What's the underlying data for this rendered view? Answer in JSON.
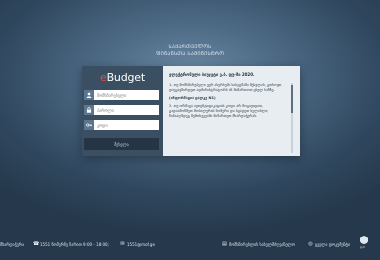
{
  "header": {
    "line1": "ᲡᲐᲥᲐᲠᲗᲕᲔᲚᲝᲡ",
    "line2": "ᲤᲘᲜᲐᲜᲡᲗᲐ ᲡᲐᲛᲘᲜᲘᲡᲢᲠᲝ"
  },
  "login": {
    "logo_prefix": "e",
    "logo_text": "Budget",
    "username_placeholder": "მომხმარებელი",
    "password_placeholder": "პაროლი",
    "code_placeholder": "კოდი",
    "submit_label": "შესვლა"
  },
  "info": {
    "title": "ელექტრონული ბიუჯეტი ვ.ბ. ფუ-ში 2020.",
    "paragraph1": "1. თუ მომხმარებელი ვერ ახერხებს სისტემაში შესვლას, გთხოვთ დაუკავშირდეთ ადმინისტრატორს ან მიმართოთ ცხელ ხაზზე.",
    "subheading": "(ინფორმაცია ცალკე N1)",
    "paragraph2": "2. თუ ორმაგი ავთენტიფიკაციის კოდი არ მოგივიდათ, გადაამოწმეთ მობილურის ნომერი და სცადეთ ხელახლა; წინააღმდეგ შემთხვევაში მიმართეთ მხარდაჭერას."
  },
  "footer": {
    "support": "მხარდაჭერა",
    "phone": "1551 ნომერზე ზარით 9:00 - 18:00;",
    "email": "1551@mof.ge",
    "manual": "მომხმარებლის სახელმძღვანელო",
    "gov": "ყველა დოკუმენტი",
    "ministry": "ფ.ს"
  },
  "colors": {
    "accent_logo": "#e94b3c",
    "panel_dark": "#3b4f63",
    "button": "#253545",
    "info_bg": "#e8edf1"
  }
}
